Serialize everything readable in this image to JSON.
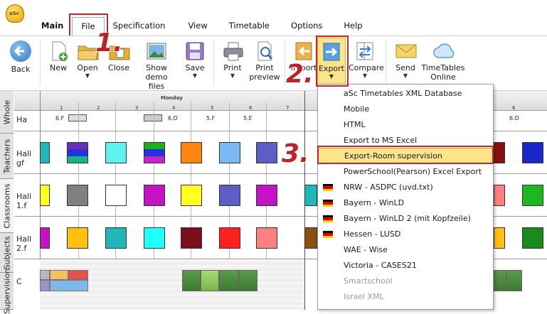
{
  "app": {
    "logo_text": "aSc"
  },
  "menu": {
    "tabs": [
      {
        "label": "Main"
      },
      {
        "label": "File"
      },
      {
        "label": "Specification"
      },
      {
        "label": "View"
      },
      {
        "label": "Timetable"
      },
      {
        "label": "Options"
      },
      {
        "label": "Help"
      }
    ]
  },
  "ribbon": {
    "back": "Back",
    "new": "New",
    "open": "Open",
    "close": "Close",
    "show_demo_line1": "Show demo",
    "show_demo_line2": "files",
    "save": "Save",
    "print": "Print",
    "print_preview_line1": "Print",
    "print_preview_line2": "preview",
    "import": "Import",
    "export": "Export",
    "compare": "Compare",
    "send": "Send",
    "timetables_online_line1": "TimeTables",
    "timetables_online_line2": "Online",
    "dropdown_arrow": "▼"
  },
  "grid": {
    "vertical_tabs": [
      "Whole",
      "Teachers",
      "Classrooms",
      "Subjects",
      "Supervision"
    ],
    "day_header": "Monday",
    "period_numbers": [
      "1",
      "2",
      "3",
      "4",
      "5",
      "6",
      "7"
    ],
    "period_numbers_right": [
      "6"
    ],
    "header_row_label": "Ha",
    "header_row_cells": [
      "6.F",
      "6.D",
      "5.F",
      "5.E"
    ],
    "header_row_cell_right": "6.D",
    "rows": [
      {
        "label": "Hall gf"
      },
      {
        "label": "Hall 1.f"
      },
      {
        "label": "Hall 2.f"
      },
      {
        "label": "C"
      }
    ]
  },
  "export_menu": {
    "items": [
      {
        "label": "aSc Timetables XML Database",
        "flag": ""
      },
      {
        "label": "Mobile",
        "flag": ""
      },
      {
        "label": "HTML",
        "flag": ""
      },
      {
        "label": "Export to MS Excel",
        "flag": ""
      },
      {
        "label": "Export-Room supervision",
        "flag": "",
        "highlighted": true
      },
      {
        "label": "PowerSchool(Pearson) Excel Export",
        "flag": ""
      },
      {
        "label": "NRW - ASDPC (uvd.txt)",
        "flag": "de"
      },
      {
        "label": "Bayern - WinLD",
        "flag": "de"
      },
      {
        "label": "Bayern - WinLD 2 (mit Kopfzeile)",
        "flag": "de"
      },
      {
        "label": "Hessen - LUSD",
        "flag": "de"
      },
      {
        "label": "WAE - Wise",
        "flag": ""
      },
      {
        "label": "Victoria - CASES21",
        "flag": ""
      },
      {
        "label": "Smartschool",
        "flag": "",
        "disabled": true
      },
      {
        "label": "Israel XML",
        "flag": "",
        "disabled": true
      }
    ]
  },
  "annotations": {
    "step1": "1.",
    "step2": "2.",
    "step3": "3."
  },
  "colors": {
    "highlight": "#fde38a",
    "annotation_red": "#c0282d",
    "flag_black": "#000000",
    "flag_red": "#dd0000",
    "flag_gold": "#ffce00"
  }
}
